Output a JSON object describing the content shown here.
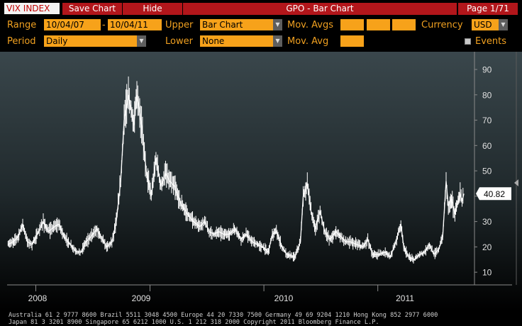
{
  "toolbar": {
    "ticker": "VIX INDEX",
    "save_label": "Save Chart",
    "hide_label": "Hide",
    "title": "GPO - Bar Chart",
    "page": "Page 1/71"
  },
  "controls": {
    "range_label": "Range",
    "range_start": "10/04/07",
    "range_dash": "-",
    "range_end": "10/04/11",
    "upper_label": "Upper",
    "upper_value": "Bar Chart",
    "mov_avgs_label": "Mov. Avgs",
    "currency_label": "Currency",
    "currency_value": "USD",
    "period_label": "Period",
    "period_value": "Daily",
    "lower_label": "Lower",
    "lower_value": "None",
    "mov_avg_label": "Mov. Avg",
    "events_label": "Events"
  },
  "chart_data": {
    "type": "line",
    "title": "",
    "xlabel": "",
    "ylabel": "",
    "x_tick_labels": [
      "2008",
      "2009",
      "2010",
      "2011"
    ],
    "y_ticks": [
      10,
      20,
      30,
      40,
      50,
      60,
      70,
      80,
      90
    ],
    "ylim": [
      5,
      97
    ],
    "grid": false,
    "last_value_label": "40.82",
    "series": [
      {
        "values": [
          [
            "2007-10-04",
            21
          ],
          [
            "2007-10-20",
            22
          ],
          [
            "2007-11-05",
            24
          ],
          [
            "2007-11-20",
            29
          ],
          [
            "2007-12-05",
            22
          ],
          [
            "2007-12-20",
            21
          ],
          [
            "2008-01-10",
            26
          ],
          [
            "2008-01-25",
            30
          ],
          [
            "2008-02-10",
            26
          ],
          [
            "2008-03-01",
            28
          ],
          [
            "2008-03-15",
            29
          ],
          [
            "2008-04-01",
            24
          ],
          [
            "2008-04-20",
            21
          ],
          [
            "2008-05-10",
            18
          ],
          [
            "2008-05-25",
            18
          ],
          [
            "2008-06-10",
            22
          ],
          [
            "2008-06-25",
            24
          ],
          [
            "2008-07-15",
            27
          ],
          [
            "2008-08-01",
            23
          ],
          [
            "2008-08-15",
            20
          ],
          [
            "2008-09-01",
            22
          ],
          [
            "2008-09-15",
            30
          ],
          [
            "2008-09-29",
            46
          ],
          [
            "2008-10-10",
            70
          ],
          [
            "2008-10-24",
            80
          ],
          [
            "2008-11-10",
            68
          ],
          [
            "2008-11-20",
            80
          ],
          [
            "2008-12-05",
            68
          ],
          [
            "2008-12-20",
            50
          ],
          [
            "2009-01-05",
            40
          ],
          [
            "2009-01-20",
            55
          ],
          [
            "2009-02-05",
            44
          ],
          [
            "2009-02-20",
            49
          ],
          [
            "2009-03-05",
            46
          ],
          [
            "2009-03-20",
            44
          ],
          [
            "2009-04-10",
            37
          ],
          [
            "2009-05-01",
            33
          ],
          [
            "2009-05-20",
            30
          ],
          [
            "2009-06-10",
            28
          ],
          [
            "2009-06-25",
            30
          ],
          [
            "2009-07-10",
            26
          ],
          [
            "2009-07-25",
            25
          ],
          [
            "2009-08-10",
            26
          ],
          [
            "2009-08-25",
            25
          ],
          [
            "2009-09-10",
            25
          ],
          [
            "2009-10-01",
            27
          ],
          [
            "2009-10-20",
            23
          ],
          [
            "2009-11-05",
            25
          ],
          [
            "2009-11-25",
            22
          ],
          [
            "2009-12-10",
            21
          ],
          [
            "2009-12-28",
            20
          ],
          [
            "2010-01-15",
            18
          ],
          [
            "2010-01-28",
            25
          ],
          [
            "2010-02-10",
            26
          ],
          [
            "2010-02-28",
            20
          ],
          [
            "2010-03-15",
            17
          ],
          [
            "2010-04-10",
            16
          ],
          [
            "2010-04-28",
            22
          ],
          [
            "2010-05-07",
            40
          ],
          [
            "2010-05-20",
            45
          ],
          [
            "2010-06-01",
            34
          ],
          [
            "2010-06-15",
            27
          ],
          [
            "2010-06-30",
            34
          ],
          [
            "2010-07-15",
            26
          ],
          [
            "2010-08-01",
            23
          ],
          [
            "2010-08-20",
            26
          ],
          [
            "2010-09-05",
            24
          ],
          [
            "2010-09-20",
            22
          ],
          [
            "2010-10-05",
            22
          ],
          [
            "2010-10-25",
            21
          ],
          [
            "2010-11-15",
            20
          ],
          [
            "2010-11-30",
            23
          ],
          [
            "2010-12-15",
            17
          ],
          [
            "2011-01-05",
            17
          ],
          [
            "2011-01-25",
            18
          ],
          [
            "2011-02-10",
            16
          ],
          [
            "2011-02-25",
            21
          ],
          [
            "2011-03-16",
            29
          ],
          [
            "2011-03-25",
            20
          ],
          [
            "2011-04-10",
            16
          ],
          [
            "2011-04-28",
            15
          ],
          [
            "2011-05-15",
            17
          ],
          [
            "2011-06-01",
            18
          ],
          [
            "2011-06-15",
            21
          ],
          [
            "2011-06-30",
            17
          ],
          [
            "2011-07-15",
            19
          ],
          [
            "2011-07-28",
            24
          ],
          [
            "2011-08-08",
            46
          ],
          [
            "2011-08-15",
            36
          ],
          [
            "2011-08-25",
            39
          ],
          [
            "2011-09-05",
            33
          ],
          [
            "2011-09-15",
            38
          ],
          [
            "2011-09-22",
            41
          ],
          [
            "2011-09-28",
            38
          ],
          [
            "2011-10-04",
            41
          ]
        ]
      }
    ]
  },
  "footer": {
    "line1": "Australia 61 2 9777 8600 Brazil 5511 3048 4500 Europe 44 20 7330 7500 Germany 49 69 9204 1210 Hong Kong 852 2977 6000",
    "line2": "Japan 81 3 3201 8900         Singapore 65 6212 1000         U.S. 1 212 318 2000         Copyright 2011 Bloomberg Finance L.P."
  },
  "colors": {
    "accent_orange": "#f7a21a",
    "label_orange": "#f0a020",
    "toolbar_red": "#b2161b",
    "price_line": "#ffffff",
    "chart_background_top": "#3a474c",
    "chart_background_bottom": "#000000"
  },
  "icons": [
    "dropdown-arrow-icon",
    "checkbox-icon",
    "scroll-indicator-icon"
  ]
}
